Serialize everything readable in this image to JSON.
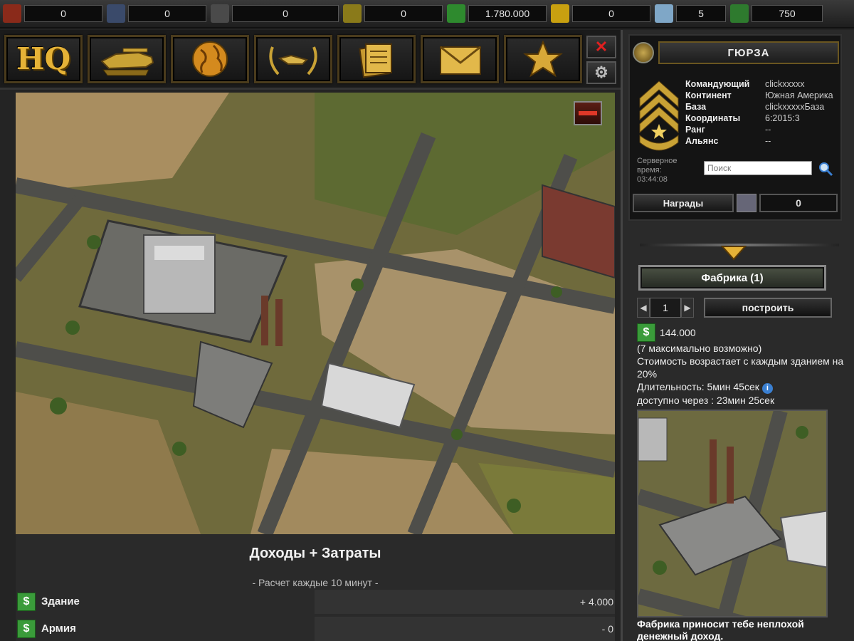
{
  "resources": [
    {
      "icon": "oil-barrel-icon",
      "value": "0",
      "color": "#8a2a1a",
      "width": 110
    },
    {
      "icon": "fuel-barrel-icon",
      "value": "0",
      "color": "#3a4a6a",
      "width": 110
    },
    {
      "icon": "ammo-barrel-icon",
      "value": "0",
      "color": "#4a4a4a",
      "width": 150
    },
    {
      "icon": "ammo-crate-icon",
      "value": "0",
      "color": "#8a7a1a",
      "width": 110
    },
    {
      "icon": "dollar-icon",
      "value": "1.780.000",
      "color": "#2e8a2e",
      "width": 110
    },
    {
      "icon": "gold-bar-icon",
      "value": "0",
      "color": "#c8a010",
      "width": 110
    },
    {
      "icon": "diamond-icon",
      "value": "5",
      "color": "#7fa7c7",
      "width": 70
    },
    {
      "icon": "rank-up-icon",
      "value": "750",
      "color": "#2e7a2e",
      "width": 100
    }
  ],
  "nav": {
    "hq_label": "HQ"
  },
  "profile": {
    "name": "ГЮРЗА",
    "fields": [
      {
        "k": "Командующий",
        "v": "clickxxxxx"
      },
      {
        "k": "Континент",
        "v": "Южная Америка"
      },
      {
        "k": "База",
        "v": "clickxxxxxБаза"
      },
      {
        "k": "Координаты",
        "v": "6:2015:3"
      },
      {
        "k": "Ранг",
        "v": "--"
      },
      {
        "k": "Альянс",
        "v": "--"
      }
    ],
    "server_time_label": "Серверное время:",
    "server_time": "03:44:08",
    "search_placeholder": "Поиск",
    "awards_label": "Награды",
    "awards_count": "0"
  },
  "build": {
    "name": "Фабрика  (1)",
    "qty": "1",
    "build_label": "построить",
    "cost": "144.000",
    "max_note": "(7 максимально возможно)",
    "cost_note": "Стоимость возрастает с каждым зданием на 20%",
    "duration": "Длительность: 5мин 45сек",
    "available": "доступно через : 23мин 25сек",
    "description": "Фабрика приносит тебе неплохой денежный доход."
  },
  "income": {
    "title": "Доходы + Затраты",
    "subtitle": "- Расчет каждые 10 минут -",
    "rows": [
      {
        "label": "Здание",
        "value": "+ 4.000"
      },
      {
        "label": "Армия",
        "value": "- 0"
      }
    ]
  }
}
